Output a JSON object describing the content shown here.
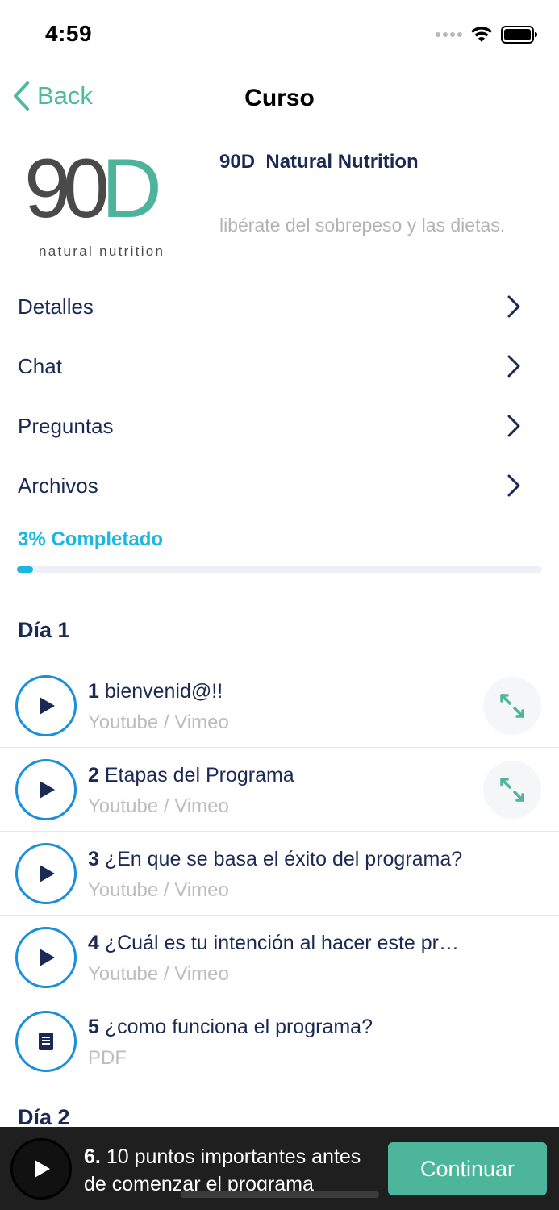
{
  "status_bar": {
    "time": "4:59"
  },
  "nav": {
    "back_label": "Back",
    "title": "Curso"
  },
  "course": {
    "logo_main": "90",
    "logo_accent": "D",
    "logo_tagline": "natural nutrition",
    "title": "90D  Natural Nutrition",
    "subtitle": "libérate del sobrepeso y las dietas."
  },
  "menu": [
    {
      "label": "Detalles"
    },
    {
      "label": "Chat"
    },
    {
      "label": "Preguntas"
    },
    {
      "label": "Archivos"
    }
  ],
  "progress": {
    "label": "3% Completado",
    "percent": 3
  },
  "days": [
    {
      "heading": "Día 1",
      "lessons": [
        {
          "number": "1",
          "title": "bienvenid@!!",
          "source": "Youtube / Vimeo",
          "icon": "play-icon",
          "expandable": true
        },
        {
          "number": "2",
          "title": "Etapas del Programa",
          "source": "Youtube / Vimeo",
          "icon": "play-icon",
          "expandable": true
        },
        {
          "number": "3",
          "title": "¿En que se basa el éxito del programa?",
          "source": "Youtube / Vimeo",
          "icon": "play-icon",
          "expandable": false
        },
        {
          "number": "4",
          "title": "¿Cuál es tu intención al hacer este pr…",
          "source": "Youtube / Vimeo",
          "icon": "play-icon",
          "expandable": false
        },
        {
          "number": "5",
          "title": "¿como funciona el programa?",
          "source": "PDF",
          "icon": "document-icon",
          "expandable": false
        }
      ]
    },
    {
      "heading": "Día 2",
      "lessons": []
    }
  ],
  "player": {
    "number": "6.",
    "title": "10 puntos importantes antes de comenzar el programa",
    "continue_label": "Continuar"
  },
  "colors": {
    "accent_green": "#4db59a",
    "accent_blue": "#1ab8e0",
    "ring_blue": "#1a8fdc",
    "navy_text": "#1b2a55"
  }
}
